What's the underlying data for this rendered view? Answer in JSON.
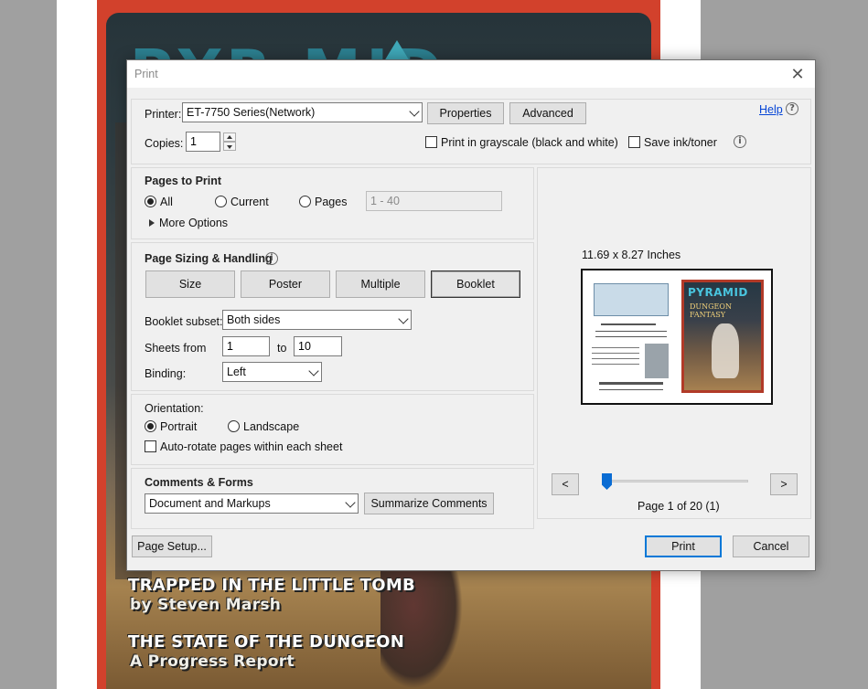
{
  "background": {
    "cover_lines": [
      "TRAPPED IN THE LITTLE TOMB",
      "by Steven Marsh",
      "THE STATE OF THE DUNGEON",
      "A Progress Report"
    ],
    "masthead": "PYR MID"
  },
  "dialog": {
    "title": "Print",
    "help_label": "Help",
    "printer_label": "Printer:",
    "printer_value": "ET-7750 Series(Network)",
    "properties_label": "Properties",
    "advanced_label": "Advanced",
    "copies_label": "Copies:",
    "copies_value": "1",
    "grayscale_label": "Print in grayscale (black and white)",
    "save_ink_label": "Save ink/toner"
  },
  "pages_to_print": {
    "heading": "Pages to Print",
    "all_label": "All",
    "current_label": "Current",
    "pages_label": "Pages",
    "pages_range": "1 - 40",
    "more_options_label": "More Options"
  },
  "page_sizing": {
    "heading": "Page Sizing & Handling",
    "tabs": [
      "Size",
      "Poster",
      "Multiple",
      "Booklet"
    ],
    "booklet_subset_label": "Booklet subset:",
    "booklet_subset_value": "Both sides",
    "sheets_from_label": "Sheets from",
    "sheets_from_value": "1",
    "to_label": "to",
    "sheets_to_value": "10",
    "binding_label": "Binding:",
    "binding_value": "Left"
  },
  "orientation": {
    "heading": "Orientation:",
    "portrait_label": "Portrait",
    "landscape_label": "Landscape",
    "autorotate_label": "Auto-rotate pages within each sheet"
  },
  "comments_forms": {
    "heading": "Comments & Forms",
    "value": "Document and Markups",
    "summarize_label": "Summarize Comments"
  },
  "preview": {
    "size_text": "11.69 x 8.27 Inches",
    "prev_label": "<",
    "next_label": ">",
    "page_status": "Page 1 of 20 (1)",
    "cover_title": "PYRAMID",
    "cover_subtitle": "DUNGEON FANTASY",
    "slider_position": 0
  },
  "footer": {
    "page_setup_label": "Page Setup...",
    "print_label": "Print",
    "cancel_label": "Cancel"
  }
}
